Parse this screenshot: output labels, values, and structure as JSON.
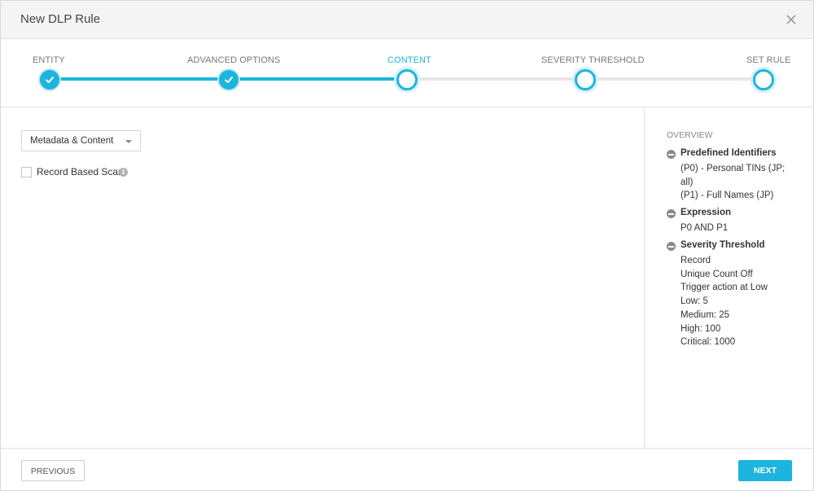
{
  "dialog": {
    "title": "New DLP Rule"
  },
  "steps": [
    {
      "label": "ENTITY",
      "state": "done"
    },
    {
      "label": "ADVANCED OPTIONS",
      "state": "done"
    },
    {
      "label": "CONTENT",
      "state": "active"
    },
    {
      "label": "SEVERITY THRESHOLD",
      "state": "todo"
    },
    {
      "label": "SET RULE",
      "state": "todo"
    }
  ],
  "content": {
    "scan_type": {
      "selected": "Metadata & Content"
    },
    "record_scan": {
      "label": "Record Based Scan",
      "checked": false
    }
  },
  "overview": {
    "title": "OVERVIEW",
    "groups": [
      {
        "title": "Predefined Identifiers",
        "lines": [
          "(P0) - Personal TINs (JP;",
          "all)",
          "(P1) - Full Names (JP)"
        ]
      },
      {
        "title": "Expression",
        "lines": [
          "P0 AND P1"
        ]
      },
      {
        "title": "Severity Threshold",
        "lines": [
          "Record",
          "Unique Count Off",
          "Trigger action at Low",
          "Low: 5",
          "Medium: 25",
          "High: 100",
          "Critical: 1000"
        ]
      }
    ]
  },
  "footer": {
    "previous_label": "PREVIOUS",
    "next_label": "NEXT"
  },
  "colors": {
    "accent": "#1db4df",
    "track_inactive": "#e6e6e6"
  },
  "icons": {
    "close": "close-icon",
    "check": "checkmark-icon",
    "info": "info-icon",
    "collapse": "minus-circle-icon"
  }
}
